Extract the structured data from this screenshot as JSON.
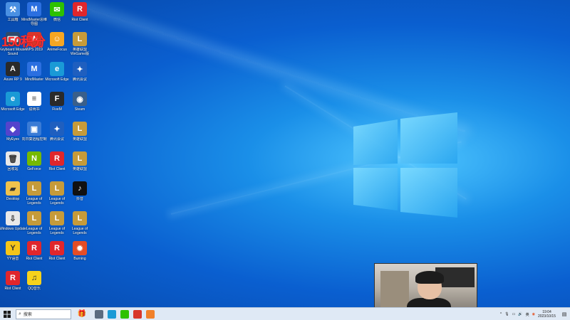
{
  "overlay": {
    "score_text": "150积分"
  },
  "desktop_icons": [
    {
      "label": "工具箱",
      "color": "#4a90e2",
      "glyph": "⚒"
    },
    {
      "label": "MindMaster思维导图",
      "color": "#2b6fe0",
      "glyph": "M"
    },
    {
      "label": "微信",
      "color": "#2dc100",
      "glyph": "✉"
    },
    {
      "label": "Riot Client",
      "color": "#e0262c",
      "glyph": "R"
    },
    {
      "label": "Keyboard Mouse Sound",
      "color": "#2f4a6b",
      "glyph": "⌨"
    },
    {
      "label": "WPS 2019",
      "color": "#d8362b",
      "glyph": "W"
    },
    {
      "label": "AnimeFocus",
      "color": "#f5a623",
      "glyph": "☺"
    },
    {
      "label": "英雄联盟 WeGame版",
      "color": "#c69b3a",
      "glyph": "L"
    },
    {
      "label": "Axure RP 9",
      "color": "#2a2a2a",
      "glyph": "A"
    },
    {
      "label": "MindMaster",
      "color": "#2b6fe0",
      "glyph": "M"
    },
    {
      "label": "Microsoft Edge",
      "color": "#1a9ad6",
      "glyph": "e"
    },
    {
      "label": "腾讯会议",
      "color": "#1f5fbf",
      "glyph": "✦"
    },
    {
      "label": "Microsoft Edge",
      "color": "#1a9ad6",
      "glyph": "e"
    },
    {
      "label": "说明书",
      "color": "#ffffff",
      "glyph": "≡"
    },
    {
      "label": "FiveM",
      "color": "#2a2a2a",
      "glyph": "F"
    },
    {
      "label": "Steam",
      "color": "#3a5f8a",
      "glyph": "◉"
    },
    {
      "label": "MyEyes",
      "color": "#5544cc",
      "glyph": "◆"
    },
    {
      "label": "向日葵远程控制",
      "color": "#3a7bd5",
      "glyph": "▣"
    },
    {
      "label": "腾讯会议",
      "color": "#1f5fbf",
      "glyph": "✦"
    },
    {
      "label": "英雄联盟",
      "color": "#c69b3a",
      "glyph": "L"
    },
    {
      "label": "回收站",
      "color": "#e8e8e8",
      "glyph": "🗑"
    },
    {
      "label": "GeForce",
      "color": "#76b900",
      "glyph": "N"
    },
    {
      "label": "Riot Client",
      "color": "#e0262c",
      "glyph": "R"
    },
    {
      "label": "英雄联盟",
      "color": "#c69b3a",
      "glyph": "L"
    },
    {
      "label": "Desktop",
      "color": "#f0c24c",
      "glyph": "▰"
    },
    {
      "label": "League of Legends",
      "color": "#c69b3a",
      "glyph": "L"
    },
    {
      "label": "League of Legends",
      "color": "#c69b3a",
      "glyph": "L"
    },
    {
      "label": "抖音",
      "color": "#111111",
      "glyph": "♪"
    },
    {
      "label": "Windows Update",
      "color": "#e8e8e8",
      "glyph": "⇩"
    },
    {
      "label": "League of Legends",
      "color": "#c69b3a",
      "glyph": "L"
    },
    {
      "label": "League of Legends",
      "color": "#c69b3a",
      "glyph": "L"
    },
    {
      "label": "League of Legends",
      "color": "#c69b3a",
      "glyph": "L"
    },
    {
      "label": "YY语音",
      "color": "#f5c518",
      "glyph": "Y"
    },
    {
      "label": "Riot Client",
      "color": "#e0262c",
      "glyph": "R"
    },
    {
      "label": "Riot Client",
      "color": "#e0262c",
      "glyph": "R"
    },
    {
      "label": "Burning",
      "color": "#e44d26",
      "glyph": "✹"
    },
    {
      "label": "Riot Client",
      "color": "#e0262c",
      "glyph": "R"
    },
    {
      "label": "QQ音乐",
      "color": "#f7d21c",
      "glyph": "♫"
    }
  ],
  "taskbar": {
    "search_placeholder": "搜索",
    "apps": [
      {
        "name": "task-view",
        "color": "#5a6b80"
      },
      {
        "name": "edge",
        "color": "#1a9ad6"
      },
      {
        "name": "wechat",
        "color": "#2dc100"
      },
      {
        "name": "wps",
        "color": "#d8362b"
      },
      {
        "name": "orange-app",
        "color": "#f0802a"
      }
    ],
    "tray": {
      "language": "英",
      "time": "19:04",
      "date": "2023/10/15"
    }
  }
}
